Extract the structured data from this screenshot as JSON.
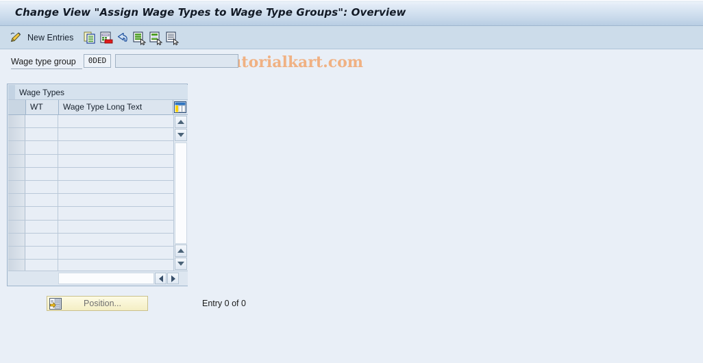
{
  "window": {
    "title": "Change View \"Assign Wage Types to Wage Type Groups\": Overview"
  },
  "toolbar": {
    "pencil_icon": "display-change-pencil-icon",
    "new_entries_label": "New Entries",
    "copy_icon": "copy-as-icon",
    "delete_icon": "delete-icon",
    "undo_icon": "undo-icon",
    "select_all_icon": "select-all-icon",
    "deselect_all_icon": "deselect-all-icon",
    "selection_icon": "selection-icon",
    "watermark": "www.tutorialkart.com",
    "watermark_color": "#f0b183"
  },
  "form": {
    "wage_type_group_label": "Wage type group",
    "wage_type_group_key": "0DED",
    "wage_type_group_text": "",
    "wage_type_group_text_placeholder": ""
  },
  "table": {
    "title": "Wage Types",
    "settings_icon": "table-settings-icon",
    "columns": [
      {
        "key": "select",
        "label": ""
      },
      {
        "key": "wt",
        "label": "WT"
      },
      {
        "key": "long_text",
        "label": "Wage Type Long Text"
      }
    ],
    "rows": [],
    "empty_row_count": 12,
    "scroll": {
      "up_icon": "scroll-up-icon",
      "down_icon": "scroll-down-icon",
      "left_icon": "scroll-left-icon",
      "right_icon": "scroll-right-icon"
    }
  },
  "footer": {
    "position_button_label": "Position...",
    "position_button_icon": "position-icon",
    "entry_count": "Entry 0 of 0"
  },
  "colors": {
    "title_bar": "#c9daeb",
    "toolbar": "#ccdcea",
    "page_background": "#e9eff7",
    "table_border": "#9eb4cb",
    "button_yellow": "#f4eec4"
  }
}
